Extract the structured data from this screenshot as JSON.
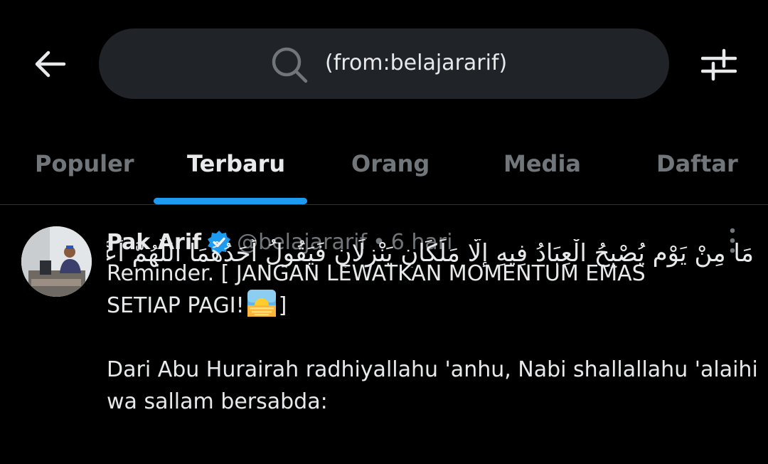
{
  "search": {
    "query": "(from:belajararif)"
  },
  "icons": {
    "back": "arrow-left-icon",
    "search": "search-icon",
    "filter": "sliders-icon",
    "verified": "verified-badge-icon",
    "more": "more-vertical-icon"
  },
  "tabs": [
    {
      "label": "Populer",
      "active": false
    },
    {
      "label": "Terbaru",
      "active": true
    },
    {
      "label": "Orang",
      "active": false
    },
    {
      "label": "Media",
      "active": false
    },
    {
      "label": "Daftar",
      "active": false
    }
  ],
  "tweet": {
    "display_name": "Pak Arif",
    "handle": "@belajararif",
    "separator": "•",
    "time": "6 hari",
    "line1": "Reminder. [ JANGAN LEWATKAN MOMENTUM EMAS",
    "line2_before": "SETIAP PAGI!",
    "line2_after": "]",
    "emoji": "sunrise",
    "line3": "Dari Abu Hurairah radhiyallahu 'anhu, Nabi shallallahu 'alaihi",
    "line4": "wa sallam bersabda:",
    "arabic": "مَا مِنْ يَوْمٍ يُصْبِحُ الْعِبَادُ فِيهِ إِلَّا مَلَكَانِ يَنْزِلَانِ فَيَقُولُ أَحَدُهُمَا اللَّهُمَّ أَعْطِ مُنْفِقًا"
  },
  "colors": {
    "background": "#000000",
    "search_bg": "#202327",
    "accent": "#1d9bf0",
    "text_primary": "#e7e9ea",
    "text_secondary": "#71767b",
    "divider": "#2f3336"
  }
}
